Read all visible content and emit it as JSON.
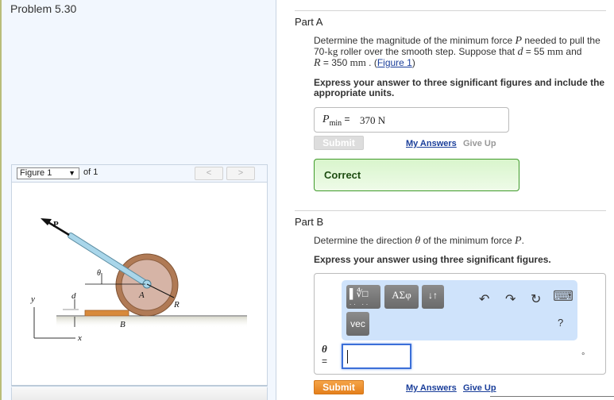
{
  "problem": {
    "title": "Problem 5.30"
  },
  "figure_viewer": {
    "selected": "Figure 1",
    "of_label": "of 1",
    "prev_label": "<",
    "next_label": ">",
    "labels": {
      "P": "P",
      "theta": "θ",
      "A": "A",
      "R": "R",
      "d": "d",
      "B": "B",
      "y": "y",
      "x": "x"
    },
    "colors": {
      "roller": "#b07a55",
      "roller_inner": "#d6b4a6",
      "handle": "#9fcde0",
      "step": "#d88a3c",
      "ground": "#e8e8dc"
    }
  },
  "part_a": {
    "title": "Part A",
    "question_pre": "Determine the magnitude of the minimum force ",
    "var_P": "P",
    "question_mid1": " needed to pull the ",
    "mass": "70-",
    "mass_unit": "kg",
    "question_mid2": " roller over the smooth step. Suppose that ",
    "var_d": "d",
    "d_val": " = 55 ",
    "d_unit": "mm",
    "question_mid3": " and ",
    "var_R": "R",
    "R_val": " = 350 ",
    "R_unit": "mm",
    "question_end": " . (",
    "figure_link": "Figure 1",
    "question_close": ")",
    "instruction": "Express your answer to three significant figures and include the appropriate units.",
    "answer_label": "P",
    "answer_sub": "min",
    "answer_eq": " = ",
    "answer_value": "370 N",
    "submit_label": "Submit",
    "my_answers_label": "My Answers",
    "give_up_label": "Give Up",
    "feedback": "Correct"
  },
  "part_b": {
    "title": "Part B",
    "question_pre": "Determine the direction ",
    "var_theta": "θ",
    "question_mid": " of the minimum force ",
    "var_P": "P",
    "question_end": ".",
    "instruction": "Express your answer using three significant figures.",
    "toolbar": {
      "templates_label": "▌∜□",
      "greek_label": "ΑΣφ",
      "arrows_label": "↓↑",
      "vec_label": "vec",
      "undo_icon": "↶",
      "redo_icon": "↷",
      "reset_icon": "↻",
      "keyboard_icon": "⌨",
      "help_label": "?"
    },
    "answer_label": "θ",
    "answer_eq": "=",
    "answer_value": "",
    "unit": "°",
    "submit_label": "Submit",
    "my_answers_label": "My Answers",
    "give_up_label": "Give Up"
  }
}
